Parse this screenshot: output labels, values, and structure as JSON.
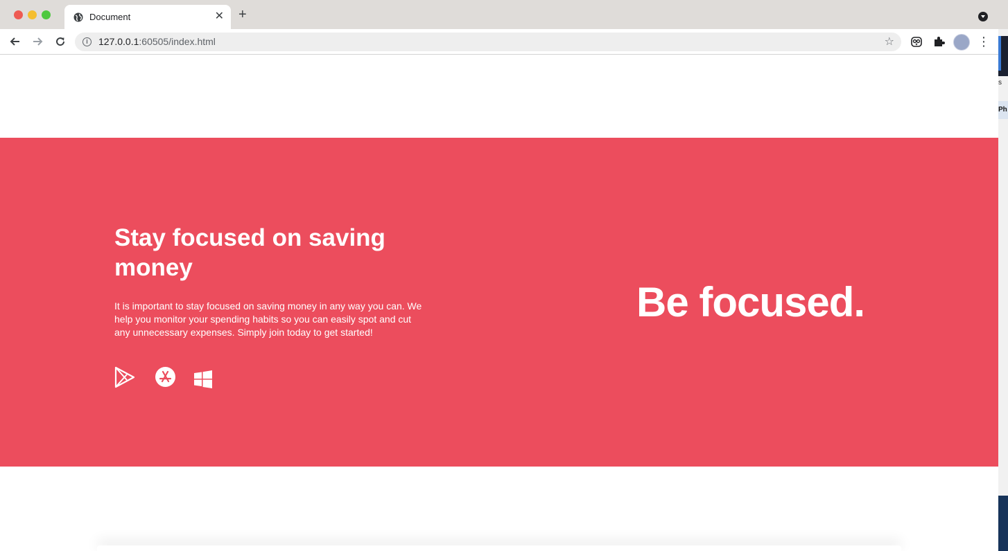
{
  "browser": {
    "tab_title": "Document",
    "tab_close": "✕",
    "new_tab": "+",
    "url_host": "127.0.0.1",
    "url_rest": ":60505/index.html",
    "icons": {
      "back": "arrow-left-icon",
      "forward": "arrow-right-icon",
      "reload": "reload-icon",
      "info": "info-icon",
      "star": "star-icon",
      "extension_owl": "owl-extension-icon",
      "extensions": "puzzle-icon",
      "menu": "kebab-menu-icon"
    }
  },
  "side_strip": {
    "text1": "s",
    "text2": "Ph"
  },
  "hero": {
    "heading": "Stay focused on saving money",
    "body": "It is important to stay focused on saving money in any way you can. We help you monitor your spending habits so you can easily spot and cut any unnecessary expenses. Simply join today to get started!",
    "tagline": "Be focused.",
    "background_color": "#ec4d5d",
    "store_icons": [
      "google-play-icon",
      "app-store-icon",
      "windows-icon"
    ]
  }
}
